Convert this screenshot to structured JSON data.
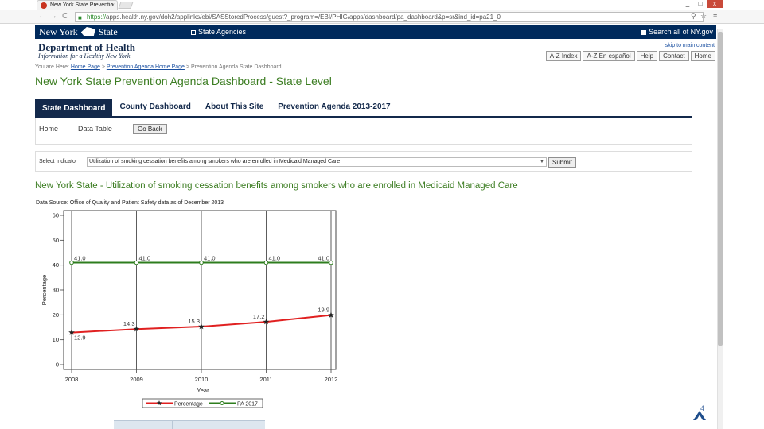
{
  "browser": {
    "tab_title": "New York State Preventio",
    "tab_close": "×",
    "url_scheme": "https://",
    "url_rest": "apps.health.ny.gov/doh2/applinks/ebi/SASStoredProcess/guest?_program=/EBI/PHIG/apps/dashboard/pa_dashboard&p=sr&ind_id=pa21_0",
    "back": "←",
    "forward": "→",
    "reload": "C",
    "minimize": "_",
    "maximize": "□",
    "close": "x",
    "star": "☆",
    "search": "⚲",
    "menu": "≡"
  },
  "site": {
    "ny_left": "New York",
    "ny_right": "State",
    "agencies": "State Agencies",
    "search_all": "Search all of NY.gov",
    "dept_title": "Department of Health",
    "dept_sub": "Information for a Healthy New York",
    "skip": "skip to main content",
    "util_nav": [
      "A-Z Index",
      "A-Z En español",
      "Help",
      "Contact",
      "Home"
    ]
  },
  "breadcrumb": {
    "prefix": "You are Here:",
    "home": "Home Page",
    "sep": ">",
    "agenda_home": "Prevention Agenda Home Page",
    "current": "Prevention Agenda State Dashboard"
  },
  "page_title": "New York State Prevention Agenda Dashboard - State Level",
  "main_nav": [
    "State Dashboard",
    "County Dashboard",
    "About This Site",
    "Prevention Agenda 2013-2017"
  ],
  "sub_nav": {
    "home": "Home",
    "data_table": "Data Table",
    "go_back": "Go Back"
  },
  "indicator": {
    "label": "Select Indicator",
    "selected": "Utilization of smoking cessation benefits among smokers who are enrolled in Medicaid Managed Care",
    "arrow": "▼",
    "submit": "Submit"
  },
  "chart_heading": "New York State - Utilization of smoking cessation benefits among smokers who are enrolled in Medicaid Managed Care",
  "data_source": "Data Source: Office of Quality and Patient Safety data as of December 2013",
  "chart_data": {
    "type": "line",
    "x": [
      2008,
      2009,
      2010,
      2011,
      2012
    ],
    "series": [
      {
        "name": "Percentage",
        "values": [
          12.9,
          14.3,
          15.3,
          17.2,
          19.9
        ],
        "labels": [
          "12.9",
          "14.3",
          "15.3",
          "17.2",
          "19.9"
        ],
        "color": "#e02020",
        "marker": "star"
      },
      {
        "name": "PA 2017",
        "values": [
          41.0,
          41.0,
          41.0,
          41.0,
          41.0
        ],
        "labels": [
          "41.0",
          "41.0",
          "41.0",
          "41.0",
          "41.0"
        ],
        "color": "#2e7d1e",
        "marker": "circle"
      }
    ],
    "xlabel": "Year",
    "ylabel": "Percentage",
    "ylim": [
      0,
      60
    ],
    "yticks": [
      0,
      10,
      20,
      30,
      40,
      50,
      60
    ],
    "grid": "vertical",
    "legend_position": "bottom"
  },
  "slide_number": "4"
}
